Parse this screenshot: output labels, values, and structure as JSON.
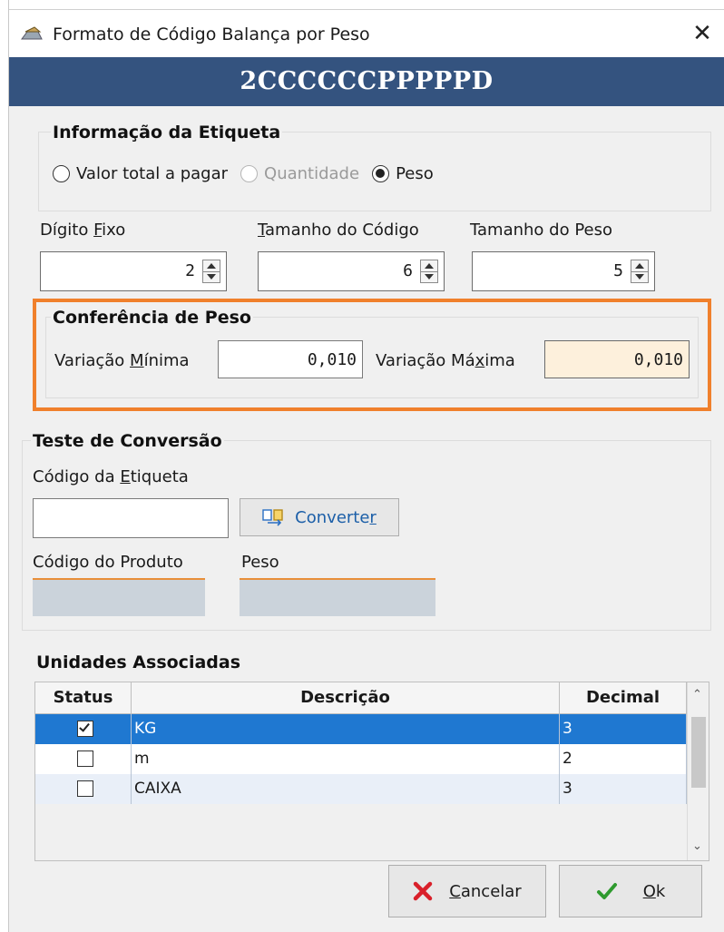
{
  "window": {
    "title": "Formato de Código Balança por Peso",
    "close_glyph": "✕",
    "banner": "2CCCCCCPPPPPD"
  },
  "label_info": {
    "legend": "Informação da Etiqueta",
    "options": [
      {
        "label": "Valor total a pagar",
        "selected": false,
        "enabled": true
      },
      {
        "label": "Quantidade",
        "selected": false,
        "enabled": false
      },
      {
        "label": "Peso",
        "selected": true,
        "enabled": true
      }
    ]
  },
  "fields": {
    "digito_fixo": {
      "label_pre": "Dígito ",
      "label_key": "F",
      "label_post": "ixo",
      "value": "2"
    },
    "tamanho_codigo": {
      "label_pre": "",
      "label_key": "T",
      "label_post": "amanho do Código",
      "value": "6"
    },
    "tamanho_peso": {
      "label_pre": "Tamanho do Peso",
      "label_key": "",
      "label_post": "",
      "value": "5"
    }
  },
  "weight_check": {
    "legend": "Conferência de Peso",
    "min_label_pre": "Variação ",
    "min_label_key": "M",
    "min_label_post": "ínima",
    "min_value": "0,010",
    "max_label_pre": "Variação Má",
    "max_label_key": "x",
    "max_label_post": "ima",
    "max_value": "0,010"
  },
  "conversion": {
    "legend": "Teste de Conversão",
    "code_label_pre": "Código da ",
    "code_label_key": "E",
    "code_label_post": "tiqueta",
    "code_value": "",
    "convert_label_pre": "Converte",
    "convert_label_key": "r",
    "product_code_label": "Código do Produto",
    "weight_label": "Peso"
  },
  "units": {
    "legend": "Unidades Associadas",
    "columns": [
      "Status",
      "Descrição",
      "Decimal"
    ],
    "rows": [
      {
        "checked": true,
        "descricao": "KG",
        "decimal": "3",
        "selected": true
      },
      {
        "checked": false,
        "descricao": "m",
        "decimal": "2",
        "selected": false
      },
      {
        "checked": false,
        "descricao": "CAIXA",
        "decimal": "3",
        "selected": false
      }
    ]
  },
  "buttons": {
    "cancel_key": "C",
    "cancel_post": "ancelar",
    "ok_key": "O",
    "ok_post": "k"
  },
  "colors": {
    "banner": "#34537f",
    "highlight": "#f0802c",
    "selected_row": "#1f78d1",
    "cancel_icon": "#d9202a",
    "ok_icon": "#2e9a2e"
  }
}
